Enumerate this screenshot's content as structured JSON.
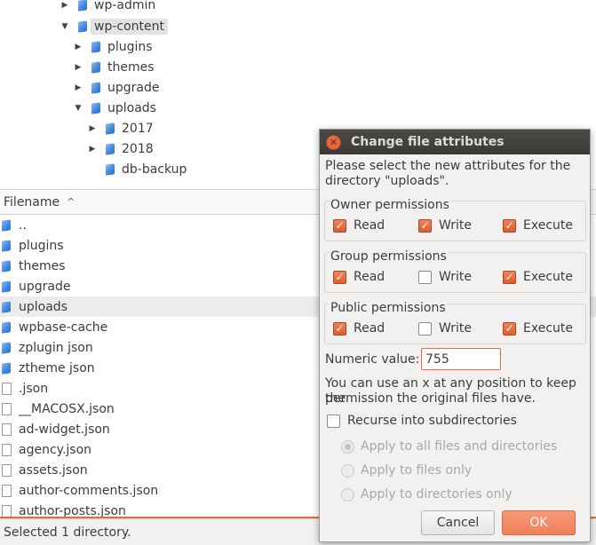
{
  "tree": {
    "items": [
      {
        "label": "wp-admin",
        "arrow": "▶",
        "selected": false
      },
      {
        "label": "wp-content",
        "arrow": "▼",
        "selected": true
      },
      {
        "label": "plugins",
        "arrow": "▶",
        "selected": false
      },
      {
        "label": "themes",
        "arrow": "▶",
        "selected": false
      },
      {
        "label": "upgrade",
        "arrow": "▶",
        "selected": false
      },
      {
        "label": "uploads",
        "arrow": "▼",
        "selected": false
      },
      {
        "label": "2017",
        "arrow": "▶",
        "selected": false
      },
      {
        "label": "2018",
        "arrow": "▶",
        "selected": false
      },
      {
        "label": "db-backup",
        "arrow": "",
        "selected": false
      }
    ]
  },
  "filelist": {
    "header": "Filename",
    "sort_indicator": "^",
    "rows": [
      {
        "name": "..",
        "type": "folder"
      },
      {
        "name": "plugins",
        "type": "folder"
      },
      {
        "name": "themes",
        "type": "folder"
      },
      {
        "name": "upgrade",
        "type": "folder"
      },
      {
        "name": "uploads",
        "type": "folder",
        "selected": true
      },
      {
        "name": "wpbase-cache",
        "type": "folder"
      },
      {
        "name": "zplugin json",
        "type": "folder"
      },
      {
        "name": "ztheme json",
        "type": "folder"
      },
      {
        "name": ".json",
        "type": "file"
      },
      {
        "name": "__MACOSX.json",
        "type": "file"
      },
      {
        "name": "ad-widget.json",
        "type": "file"
      },
      {
        "name": "agency.json",
        "type": "file"
      },
      {
        "name": "assets.json",
        "type": "file"
      },
      {
        "name": "author-comments.json",
        "type": "file"
      },
      {
        "name": "author-posts.json",
        "type": "file"
      }
    ]
  },
  "status": {
    "text": "Selected 1 directory."
  },
  "dialog": {
    "title": "Change file attributes",
    "close_glyph": "✕",
    "intro_line1": "Please select the new attributes for the",
    "intro_line2": "directory \"uploads\".",
    "groups": [
      {
        "title": "Owner permissions",
        "read": true,
        "write": true,
        "execute": true
      },
      {
        "title": "Group permissions",
        "read": true,
        "write": false,
        "execute": true
      },
      {
        "title": "Public permissions",
        "read": true,
        "write": false,
        "execute": true
      }
    ],
    "labels": {
      "read": "Read",
      "write": "Write",
      "execute": "Execute"
    },
    "check_glyph": "✓",
    "numeric_label": "Numeric value:",
    "numeric_value": "755",
    "hint_line1": "You can use an x at any position to keep the",
    "hint_line2": "permission the original files have.",
    "recurse_label": "Recurse into subdirectories",
    "recurse_checked": false,
    "radio_options": [
      {
        "label": "Apply to all files and directories",
        "selected": true
      },
      {
        "label": "Apply to files only",
        "selected": false
      },
      {
        "label": "Apply to directories only",
        "selected": false
      }
    ],
    "cancel_label": "Cancel",
    "ok_label": "OK"
  },
  "colors": {
    "accent": "#e8693e",
    "folder": "#3f86e0",
    "titlebar": "#3c3b37"
  }
}
